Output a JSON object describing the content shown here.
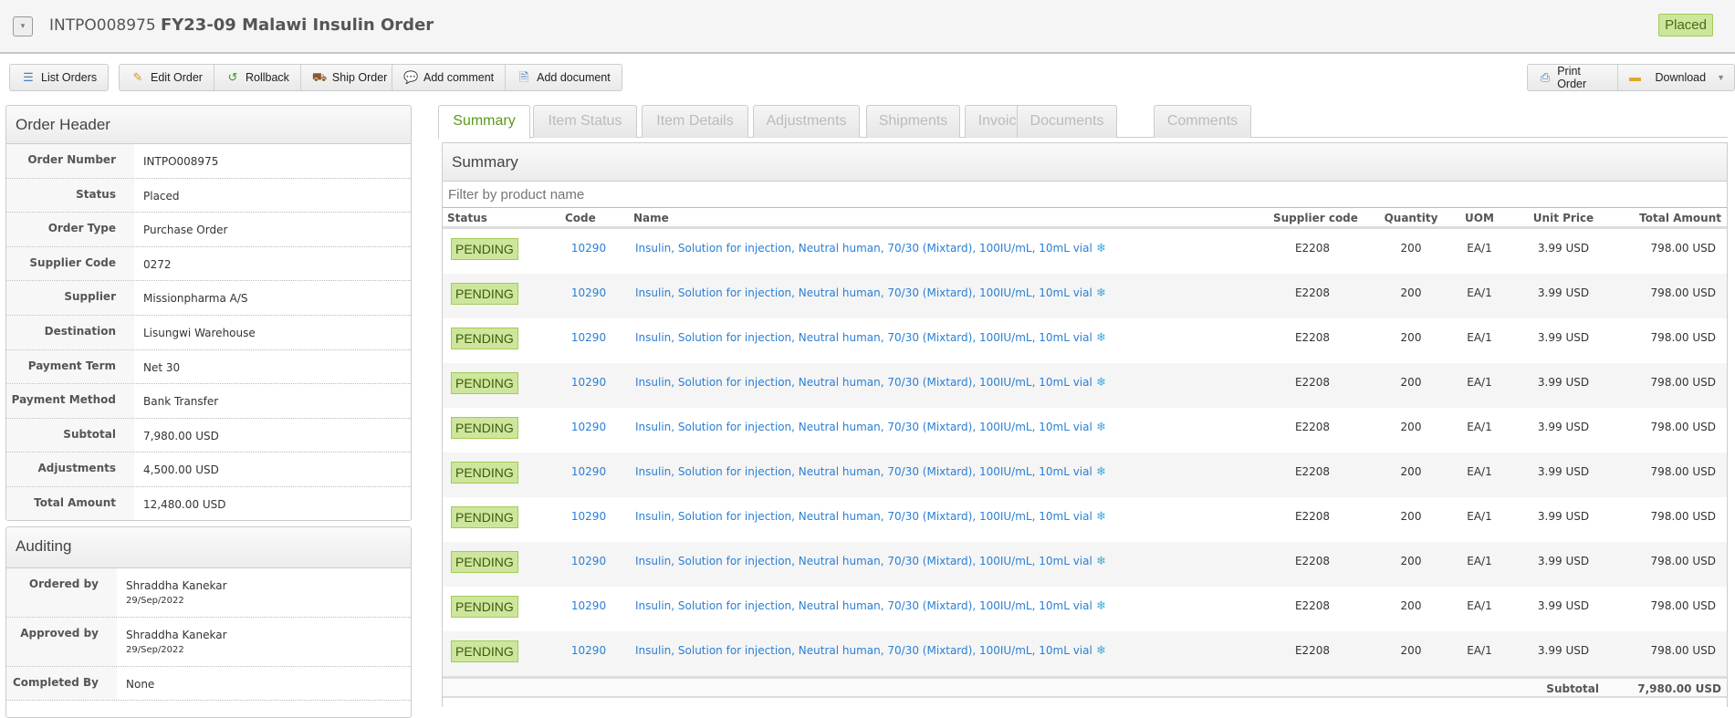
{
  "header": {
    "order_number": "INTPO008975",
    "order_name": "FY23-09 Malawi Insulin Order",
    "status_badge": "Placed",
    "menu_toggle": "▾"
  },
  "toolbar": {
    "list_orders": "List Orders",
    "edit_order": "Edit Order",
    "rollback": "Rollback",
    "ship_order": "Ship Order",
    "add_comment": "Add comment",
    "add_document": "Add document",
    "print_order": "Print Order",
    "download": "Download"
  },
  "order_header": {
    "title": "Order Header",
    "fields": [
      {
        "label": "Order Number",
        "value": "INTPO008975"
      },
      {
        "label": "Status",
        "value": "Placed"
      },
      {
        "label": "Order Type",
        "value": "Purchase Order"
      },
      {
        "label": "Supplier Code",
        "value": "0272"
      },
      {
        "label": "Supplier",
        "value": "Missionpharma A/S"
      },
      {
        "label": "Destination",
        "value": "Lisungwi Warehouse"
      },
      {
        "label": "Payment Term",
        "value": "Net 30"
      },
      {
        "label": "Payment Method",
        "value": "Bank Transfer"
      },
      {
        "label": "Subtotal",
        "value": "7,980.00 USD"
      },
      {
        "label": "Adjustments",
        "value": "4,500.00 USD"
      },
      {
        "label": "Total Amount",
        "value": "12,480.00 USD"
      }
    ]
  },
  "auditing": {
    "title": "Auditing",
    "fields": [
      {
        "label": "Ordered by",
        "value": "Shraddha Kanekar",
        "date": "29/Sep/2022"
      },
      {
        "label": "Approved by",
        "value": "Shraddha Kanekar",
        "date": "29/Sep/2022"
      },
      {
        "label": "Completed By",
        "value": "None"
      }
    ]
  },
  "tabs": [
    "Summary",
    "Item Status",
    "Item Details",
    "Adjustments",
    "Shipments",
    "Invoices",
    "Documents",
    "Comments"
  ],
  "summary": {
    "title": "Summary",
    "filter_placeholder": "Filter by product name",
    "columns": {
      "status": "Status",
      "code": "Code",
      "name": "Name",
      "supplier_code": "Supplier code",
      "quantity": "Quantity",
      "uom": "UOM",
      "unit_price": "Unit Price",
      "total": "Total Amount"
    },
    "rows": [
      {
        "status": "PENDING",
        "code": "10290",
        "name": "Insulin, Solution for injection, Neutral human, 70/30 (Mixtard), 100IU/mL, 10mL vial",
        "supplier_code": "E2208",
        "quantity": "200",
        "uom": "EA/1",
        "unit_price": "3.99 USD",
        "total": "798.00 USD"
      },
      {
        "status": "PENDING",
        "code": "10290",
        "name": "Insulin, Solution for injection, Neutral human, 70/30 (Mixtard), 100IU/mL, 10mL vial",
        "supplier_code": "E2208",
        "quantity": "200",
        "uom": "EA/1",
        "unit_price": "3.99 USD",
        "total": "798.00 USD"
      },
      {
        "status": "PENDING",
        "code": "10290",
        "name": "Insulin, Solution for injection, Neutral human, 70/30 (Mixtard), 100IU/mL, 10mL vial",
        "supplier_code": "E2208",
        "quantity": "200",
        "uom": "EA/1",
        "unit_price": "3.99 USD",
        "total": "798.00 USD"
      },
      {
        "status": "PENDING",
        "code": "10290",
        "name": "Insulin, Solution for injection, Neutral human, 70/30 (Mixtard), 100IU/mL, 10mL vial",
        "supplier_code": "E2208",
        "quantity": "200",
        "uom": "EA/1",
        "unit_price": "3.99 USD",
        "total": "798.00 USD"
      },
      {
        "status": "PENDING",
        "code": "10290",
        "name": "Insulin, Solution for injection, Neutral human, 70/30 (Mixtard), 100IU/mL, 10mL vial",
        "supplier_code": "E2208",
        "quantity": "200",
        "uom": "EA/1",
        "unit_price": "3.99 USD",
        "total": "798.00 USD"
      },
      {
        "status": "PENDING",
        "code": "10290",
        "name": "Insulin, Solution for injection, Neutral human, 70/30 (Mixtard), 100IU/mL, 10mL vial",
        "supplier_code": "E2208",
        "quantity": "200",
        "uom": "EA/1",
        "unit_price": "3.99 USD",
        "total": "798.00 USD"
      },
      {
        "status": "PENDING",
        "code": "10290",
        "name": "Insulin, Solution for injection, Neutral human, 70/30 (Mixtard), 100IU/mL, 10mL vial",
        "supplier_code": "E2208",
        "quantity": "200",
        "uom": "EA/1",
        "unit_price": "3.99 USD",
        "total": "798.00 USD"
      },
      {
        "status": "PENDING",
        "code": "10290",
        "name": "Insulin, Solution for injection, Neutral human, 70/30 (Mixtard), 100IU/mL, 10mL vial",
        "supplier_code": "E2208",
        "quantity": "200",
        "uom": "EA/1",
        "unit_price": "3.99 USD",
        "total": "798.00 USD"
      },
      {
        "status": "PENDING",
        "code": "10290",
        "name": "Insulin, Solution for injection, Neutral human, 70/30 (Mixtard), 100IU/mL, 10mL vial",
        "supplier_code": "E2208",
        "quantity": "200",
        "uom": "EA/1",
        "unit_price": "3.99 USD",
        "total": "798.00 USD"
      },
      {
        "status": "PENDING",
        "code": "10290",
        "name": "Insulin, Solution for injection, Neutral human, 70/30 (Mixtard), 100IU/mL, 10mL vial",
        "supplier_code": "E2208",
        "quantity": "200",
        "uom": "EA/1",
        "unit_price": "3.99 USD",
        "total": "798.00 USD"
      }
    ],
    "subtotal_label": "Subtotal",
    "subtotal_value": "7,980.00 USD"
  },
  "colors": {
    "accent_green": "#5a9a1a",
    "badge_bg": "#cde69c",
    "link": "#2a7fd4"
  }
}
